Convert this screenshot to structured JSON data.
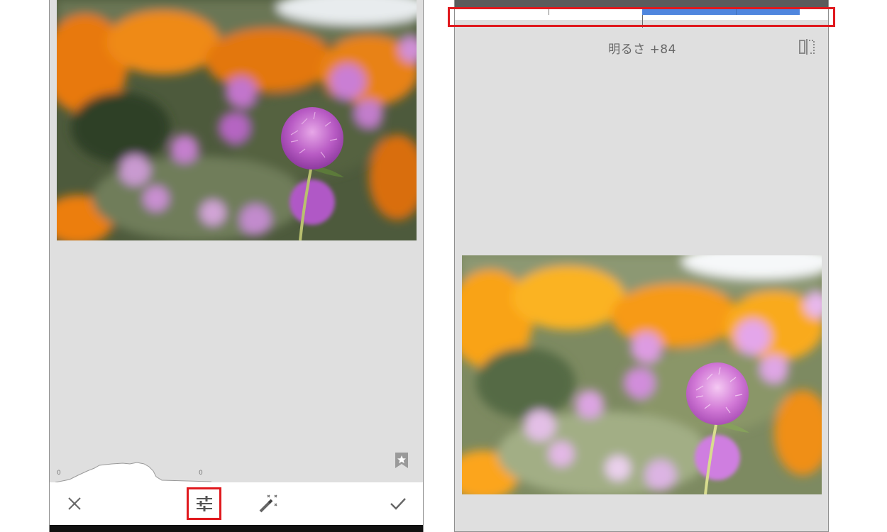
{
  "left": {
    "toolbar": {
      "close_icon": "close-icon",
      "tools_icon": "tune-sliders-icon",
      "auto_icon": "magic-wand-icon",
      "confirm_icon": "checkmark-icon"
    },
    "histogram": {
      "left_marker": "0",
      "right_marker": "0"
    },
    "style_icon": "bookmark-star-icon"
  },
  "right": {
    "adjustment": {
      "label": "明るさ +84",
      "value": 84
    },
    "compare_icon": "split-compare-icon"
  },
  "colors": {
    "panel_bg": "#dfdfdf",
    "slider_fill": "#4f86de",
    "highlight": "#e0191e"
  }
}
